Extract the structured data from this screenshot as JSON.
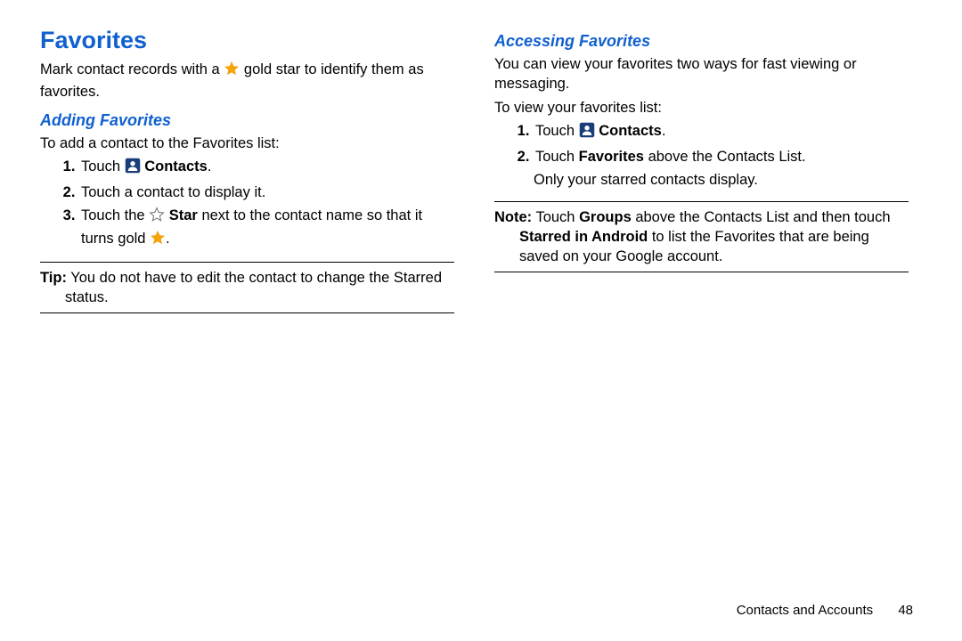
{
  "left": {
    "h1": "Favorites",
    "intro_a": "Mark contact records with a ",
    "intro_b": " gold star to identify them as favorites.",
    "h2": "Adding Favorites",
    "lead": "To add a contact to the Favorites list:",
    "step1_a": "Touch ",
    "step1_b": "Contacts",
    "step2": "Touch a contact to display it.",
    "step3_a": "Touch the ",
    "step3_b": "Star",
    "step3_c": " next to the contact name so that it turns gold ",
    "tip_label": "Tip:",
    "tip_text": " You do not have to edit the contact to change the Starred status."
  },
  "right": {
    "h2": "Accessing Favorites",
    "p1": "You can view your favorites two ways for fast viewing or messaging.",
    "p2": "To view your favorites list:",
    "step1_a": "Touch ",
    "step1_b": "Contacts",
    "step2_a": "Touch ",
    "step2_b": "Favorites",
    "step2_c": " above the Contacts List.",
    "step2_extra": "Only your starred contacts display.",
    "note_label": "Note:",
    "note_a": " Touch ",
    "note_b": "Groups",
    "note_c": " above the Contacts List and then touch ",
    "note_d": "Starred in Android",
    "note_e": " to list the Favorites that are being saved on your Google account."
  },
  "footer": {
    "section": "Contacts and Accounts",
    "page": "48"
  }
}
